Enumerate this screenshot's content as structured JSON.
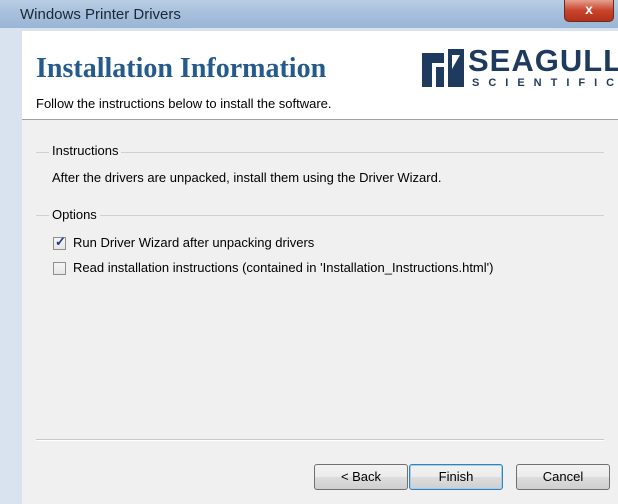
{
  "window": {
    "title": "Windows Printer Drivers",
    "close_glyph": "x"
  },
  "header": {
    "title": "Installation Information",
    "subtitle": "Follow the instructions below to install the software.",
    "logo": {
      "word": "SEAGULL",
      "sub": "SCIENTIFIC"
    }
  },
  "instructions": {
    "label": "Instructions",
    "text": "After the drivers are unpacked, install them using the Driver Wizard."
  },
  "options": {
    "label": "Options",
    "items": [
      {
        "label": "Run Driver Wizard after unpacking drivers",
        "checked": true
      },
      {
        "label": "Read installation instructions (contained in 'Installation_Instructions.html')",
        "checked": false
      }
    ]
  },
  "buttons": {
    "back": "< Back",
    "finish": "Finish",
    "cancel": "Cancel"
  },
  "colors": {
    "title_blue": "#255a8c",
    "logo_navy": "#1f3a5f",
    "close_red": "#c9432b"
  }
}
